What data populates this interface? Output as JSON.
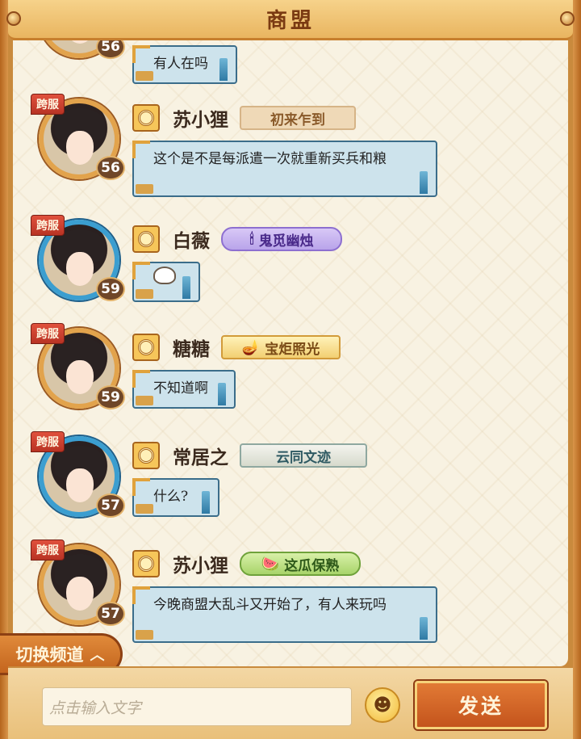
{
  "header": {
    "title": "商盟"
  },
  "top_partial": {
    "level": "56",
    "text": "有人在吗"
  },
  "messages": [
    {
      "tag": "跨服",
      "level": "56",
      "name": "苏小狸",
      "badge": "初来乍到",
      "text": "这个是不是每派遣一次就重新买兵和粮"
    },
    {
      "tag": "跨服",
      "level": "59",
      "name": "白薇",
      "badge": "鬼觅幽烛",
      "text": ""
    },
    {
      "tag": "跨服",
      "level": "59",
      "name": "糖糖",
      "badge": "宝炬照光",
      "text": "不知道啊"
    },
    {
      "tag": "跨服",
      "level": "57",
      "name": "常居之",
      "badge": "云同文迹",
      "text": "什么?"
    },
    {
      "tag": "跨服",
      "level": "57",
      "name": "苏小狸",
      "badge": "这瓜保熟",
      "text": "今晚商盟大乱斗又开始了，有人来玩吗"
    }
  ],
  "channel_button": {
    "label": "切换频道"
  },
  "input": {
    "placeholder": "点击输入文字"
  },
  "send_button": {
    "label": "发送"
  }
}
